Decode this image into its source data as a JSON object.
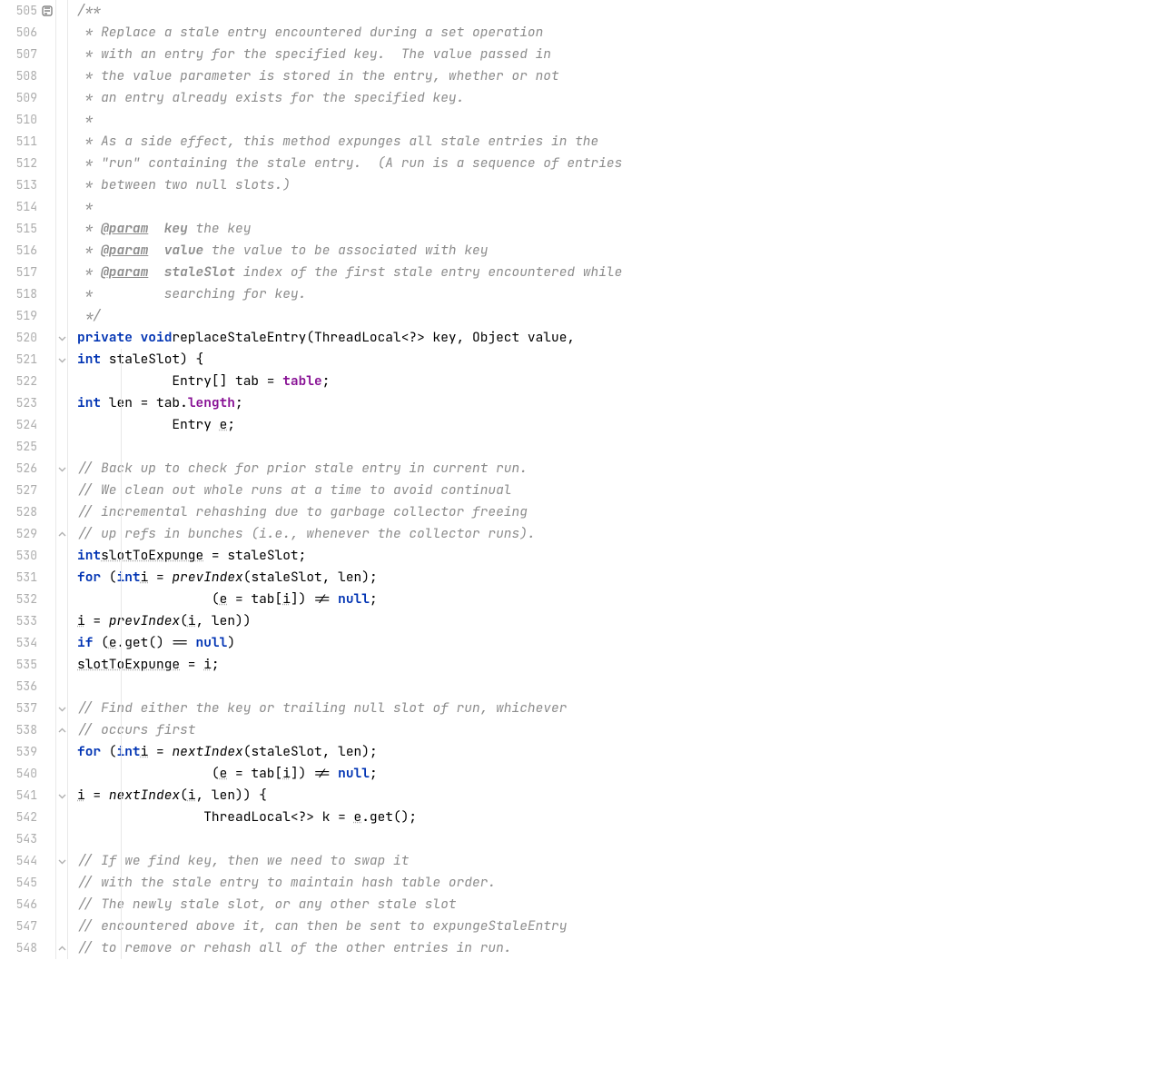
{
  "startLine": 505,
  "lines": [
    {
      "n": 505,
      "icon": "impl",
      "html": "        <span class='c-comment'>/**</span>"
    },
    {
      "n": 506,
      "html": "        <span class='c-comment'> * Replace a stale entry encountered during a set operation</span>"
    },
    {
      "n": 507,
      "html": "        <span class='c-comment'> * with an entry for the specified key.  The value passed in</span>"
    },
    {
      "n": 508,
      "html": "        <span class='c-comment'> * the value parameter is stored in the entry, whether or not</span>"
    },
    {
      "n": 509,
      "html": "        <span class='c-comment'> * an entry already exists for the specified key.</span>"
    },
    {
      "n": 510,
      "html": "        <span class='c-comment'> *</span>"
    },
    {
      "n": 511,
      "html": "        <span class='c-comment'> * As a side effect, this method expunges all stale entries in the</span>"
    },
    {
      "n": 512,
      "html": "        <span class='c-comment'> * \"run\" containing the stale entry.  (A run is a sequence of entries</span>"
    },
    {
      "n": 513,
      "html": "        <span class='c-comment'> * between two null slots.)</span>"
    },
    {
      "n": 514,
      "html": "        <span class='c-comment'> *</span>"
    },
    {
      "n": 515,
      "html": "        <span class='c-comment'> * </span><span class='c-doctag'>@param</span><span class='c-comment'>  </span><span class='c-docparam'>key</span><span class='c-comment'> the key</span>"
    },
    {
      "n": 516,
      "html": "        <span class='c-comment'> * </span><span class='c-doctag'>@param</span><span class='c-comment'>  </span><span class='c-docparam'>value</span><span class='c-comment'> the value to be associated with key</span>"
    },
    {
      "n": 517,
      "html": "        <span class='c-comment'> * </span><span class='c-doctag'>@param</span><span class='c-comment'>  </span><span class='c-docparam'>staleSlot</span><span class='c-comment'> index of the first stale entry encountered while</span>"
    },
    {
      "n": 518,
      "html": "        <span class='c-comment'> *         searching for key.</span>"
    },
    {
      "n": 519,
      "html": "        <span class='c-comment'> */</span>"
    },
    {
      "n": 520,
      "fold": "down",
      "html": "        <span class='c-keyword'>private void</span> <span class='c-method'>replaceStaleEntry</span>(ThreadLocal&lt;?&gt; key, Object value,"
    },
    {
      "n": 521,
      "fold": "down",
      "html": "                                       <span class='c-keyword'>int</span> staleSlot) <span class='c-brace'>{</span>"
    },
    {
      "n": 522,
      "html": "            Entry[] tab = <span class='c-field'>table</span>;"
    },
    {
      "n": 523,
      "html": "            <span class='c-keyword'>int</span> len = tab.<span class='c-field'>length</span>;"
    },
    {
      "n": 524,
      "html": "            Entry <span class='c-varu'>e</span>;"
    },
    {
      "n": 525,
      "html": ""
    },
    {
      "n": 526,
      "fold": "down",
      "html": "            <span class='c-comment'>// Back up to check for prior stale entry in current run.</span>"
    },
    {
      "n": 527,
      "html": "            <span class='c-comment'>// We clean out whole runs at a time to avoid continual</span>"
    },
    {
      "n": 528,
      "html": "            <span class='c-comment'>// incremental rehashing due to garbage collector freeing</span>"
    },
    {
      "n": 529,
      "fold": "up",
      "html": "            <span class='c-comment'>// up refs in bunches (i.e., whenever the collector runs).</span>"
    },
    {
      "n": 530,
      "html": "            <span class='c-keyword'>int</span> <span class='c-varu'>slotToExpunge</span> = staleSlot;"
    },
    {
      "n": 531,
      "html": "            <span class='c-keyword'>for</span> (<span class='c-keyword'>int</span> <span class='c-varu'>i</span> = <span class='c-methoditalic'>prevIndex</span>(staleSlot, len);"
    },
    {
      "n": 532,
      "html": "                 (<span class='c-varu'>e</span> = tab[<span class='c-varu'>i</span>]) != <span class='c-null'>null</span>;"
    },
    {
      "n": 533,
      "html": "                 <span class='c-varu'>i</span> = <span class='c-methoditalic'>prevIndex</span>(<span class='c-varu'>i</span>, len))"
    },
    {
      "n": 534,
      "html": "                <span class='c-keyword'>if</span> (<span class='c-varu'>e</span>.get() == <span class='c-null'>null</span>)"
    },
    {
      "n": 535,
      "html": "                    <span class='c-varu'>slotToExpunge</span> = <span class='c-varu'>i</span>;"
    },
    {
      "n": 536,
      "html": ""
    },
    {
      "n": 537,
      "fold": "down",
      "html": "            <span class='c-comment'>// Find either the key or trailing null slot of run, whichever</span>"
    },
    {
      "n": 538,
      "fold": "up",
      "html": "            <span class='c-comment'>// occurs first</span>"
    },
    {
      "n": 539,
      "html": "            <span class='c-keyword'>for</span> (<span class='c-keyword'>int</span> <span class='c-varu'>i</span> = <span class='c-methoditalic'>nextIndex</span>(staleSlot, len);"
    },
    {
      "n": 540,
      "html": "                 (<span class='c-varu'>e</span> = tab[<span class='c-varu'>i</span>]) != <span class='c-null'>null</span>;"
    },
    {
      "n": 541,
      "fold": "down",
      "html": "                 <span class='c-varu'>i</span> = <span class='c-methoditalic'>nextIndex</span>(<span class='c-varu'>i</span>, len)) {"
    },
    {
      "n": 542,
      "html": "                ThreadLocal&lt;?&gt; k = <span class='c-varu'>e</span>.get();"
    },
    {
      "n": 543,
      "html": ""
    },
    {
      "n": 544,
      "fold": "down",
      "html": "                <span class='c-comment'>// If we find key, then we need to swap it</span>"
    },
    {
      "n": 545,
      "html": "                <span class='c-comment'>// with the stale entry to maintain hash table order.</span>"
    },
    {
      "n": 546,
      "html": "                <span class='c-comment'>// The newly stale slot, or any other stale slot</span>"
    },
    {
      "n": 547,
      "html": "                <span class='c-comment'>// encountered above it, can then be sent to expungeStaleEntry</span>"
    },
    {
      "n": 548,
      "fold": "up",
      "html": "                <span class='c-comment'>// to remove or rehash all of the other entries in run.</span>"
    }
  ]
}
